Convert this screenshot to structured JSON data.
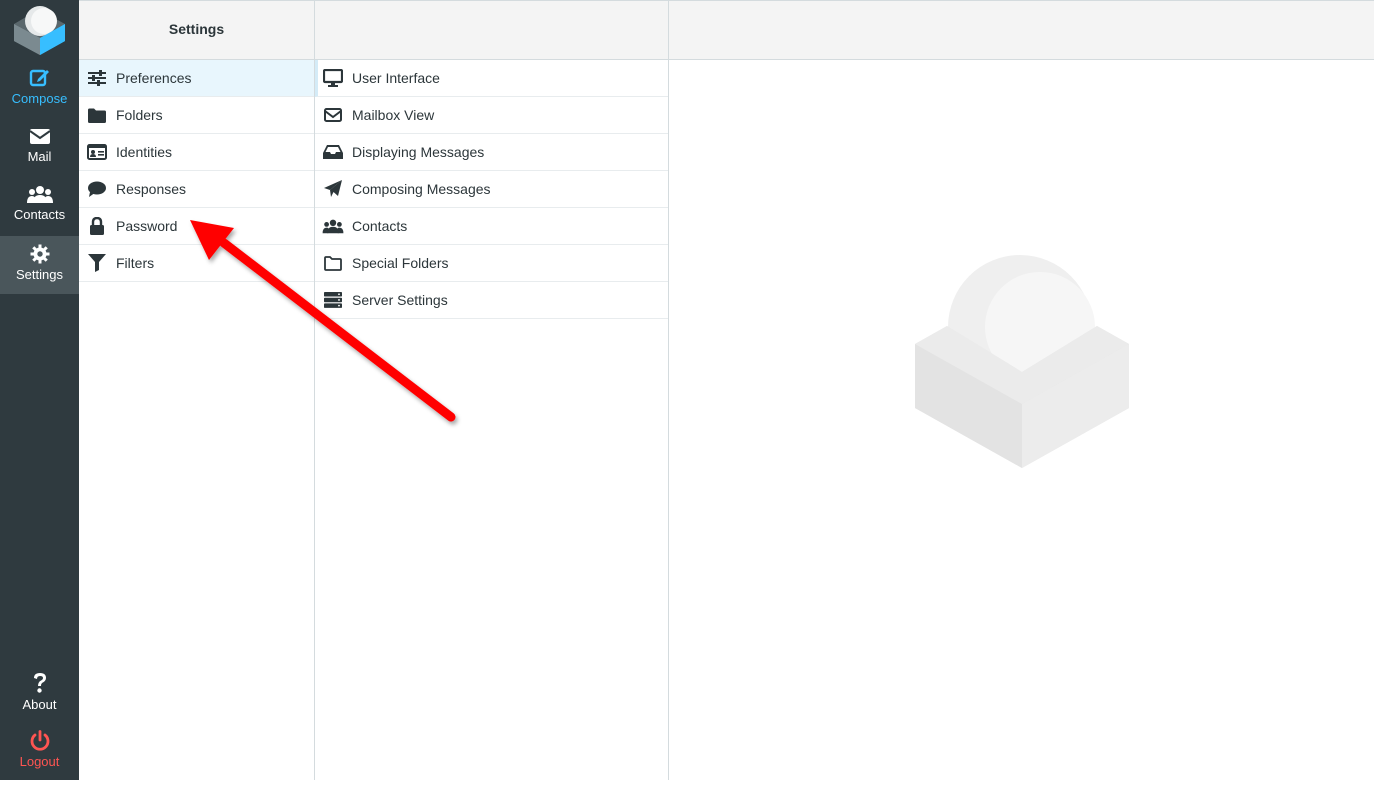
{
  "nav": {
    "items": [
      {
        "key": "compose",
        "label": "Compose",
        "icon": "compose-icon"
      },
      {
        "key": "mail",
        "label": "Mail",
        "icon": "envelope-icon"
      },
      {
        "key": "contacts",
        "label": "Contacts",
        "icon": "users-icon"
      },
      {
        "key": "settings",
        "label": "Settings",
        "icon": "gear-icon"
      }
    ],
    "bottom": [
      {
        "key": "about",
        "label": "About",
        "icon": "question-icon"
      },
      {
        "key": "logout",
        "label": "Logout",
        "icon": "power-icon"
      }
    ],
    "active": "settings"
  },
  "settings_panel": {
    "title": "Settings",
    "items": [
      {
        "label": "Preferences",
        "icon": "sliders-icon",
        "selected": true
      },
      {
        "label": "Folders",
        "icon": "folder-icon"
      },
      {
        "label": "Identities",
        "icon": "id-card-icon"
      },
      {
        "label": "Responses",
        "icon": "comment-icon"
      },
      {
        "label": "Password",
        "icon": "lock-icon"
      },
      {
        "label": "Filters",
        "icon": "filter-icon"
      }
    ]
  },
  "sections_panel": {
    "items": [
      {
        "label": "User Interface",
        "icon": "monitor-icon",
        "selected": true
      },
      {
        "label": "Mailbox View",
        "icon": "envelope-outline-icon"
      },
      {
        "label": "Displaying Messages",
        "icon": "inbox-icon"
      },
      {
        "label": "Composing Messages",
        "icon": "paper-plane-icon"
      },
      {
        "label": "Contacts",
        "icon": "users-icon"
      },
      {
        "label": "Special Folders",
        "icon": "folder-outline-icon"
      },
      {
        "label": "Server Settings",
        "icon": "server-icon"
      }
    ]
  },
  "colors": {
    "rail": "#2f3a3f",
    "accent": "#37beff",
    "logout": "#ff5552",
    "annotation": "#ff0000"
  }
}
